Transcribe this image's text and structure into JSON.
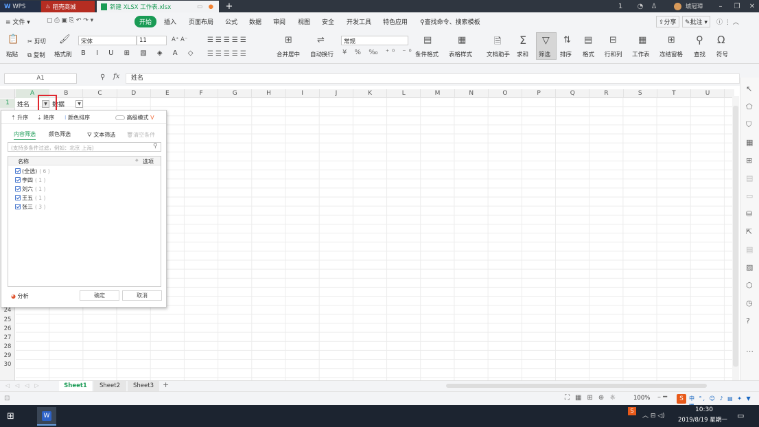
{
  "tabs": {
    "wps": "WPS",
    "docer": "稻壳商城",
    "doc": "新建 XLSX 工作表.xlsx",
    "user": "城冠璋"
  },
  "menu": {
    "file": "文件",
    "start": "开始",
    "items": [
      "插入",
      "页面布局",
      "公式",
      "数据",
      "审阅",
      "视图",
      "安全",
      "开发工具",
      "特色应用"
    ],
    "search": "查找命令、搜索模板",
    "share": "分享",
    "comment": "批注"
  },
  "ribbon": {
    "paste": "粘贴",
    "cut": "剪切",
    "copy": "复制",
    "format_painter": "格式刷",
    "font": "宋体",
    "size": "11",
    "merge": "合并居中",
    "wrap": "自动换行",
    "number_format": "常规",
    "cond_format": "条件格式",
    "table_style": "表格样式",
    "doc_helper": "文档助手",
    "sum": "求和",
    "filter": "筛选",
    "sort": "排序",
    "format": "格式",
    "rowcol": "行和列",
    "sheet": "工作表",
    "freeze": "冻结窗格",
    "find": "查找",
    "symbol": "符号"
  },
  "formula": {
    "namebox": "A1",
    "fx": "fx",
    "content": "姓名"
  },
  "columns": [
    "A",
    "B",
    "C",
    "D",
    "E",
    "F",
    "G",
    "H",
    "I",
    "J",
    "K",
    "L",
    "M",
    "N",
    "O",
    "P",
    "Q",
    "R",
    "S",
    "T",
    "U"
  ],
  "rows_top": [
    "1"
  ],
  "rows_bottom": [
    "24",
    "25",
    "26",
    "27",
    "28",
    "29",
    "30"
  ],
  "cells": {
    "a1": "姓名",
    "b1": "数据"
  },
  "filter_panel": {
    "asc": "升序",
    "desc": "降序",
    "color_sort": "颜色排序",
    "advanced": "高级模式",
    "tab_content": "内容筛选",
    "tab_color": "颜色筛选",
    "text_filter": "文本筛选",
    "clear": "清空条件",
    "search_placeholder": "(支持多条件过滤，例如：北京 上海)",
    "col_name": "名称",
    "col_option": "选项",
    "items": [
      {
        "label": "(全选)",
        "count": "( 6 )"
      },
      {
        "label": "李四",
        "count": "( 1 )"
      },
      {
        "label": "刘六",
        "count": "( 1 )"
      },
      {
        "label": "王五",
        "count": "( 1 )"
      },
      {
        "label": "张三",
        "count": "( 3 )"
      }
    ],
    "analyze": "分析",
    "ok": "确定",
    "cancel": "取消"
  },
  "sheets": [
    "Sheet1",
    "Sheet2",
    "Sheet3"
  ],
  "status": {
    "zoom": "100%"
  },
  "taskbar": {
    "time": "10:30",
    "date": "2019/8/19 星期一",
    "ime": "中"
  },
  "colors": {
    "accent": "#1a9b55",
    "highlight": "#e0262e"
  }
}
